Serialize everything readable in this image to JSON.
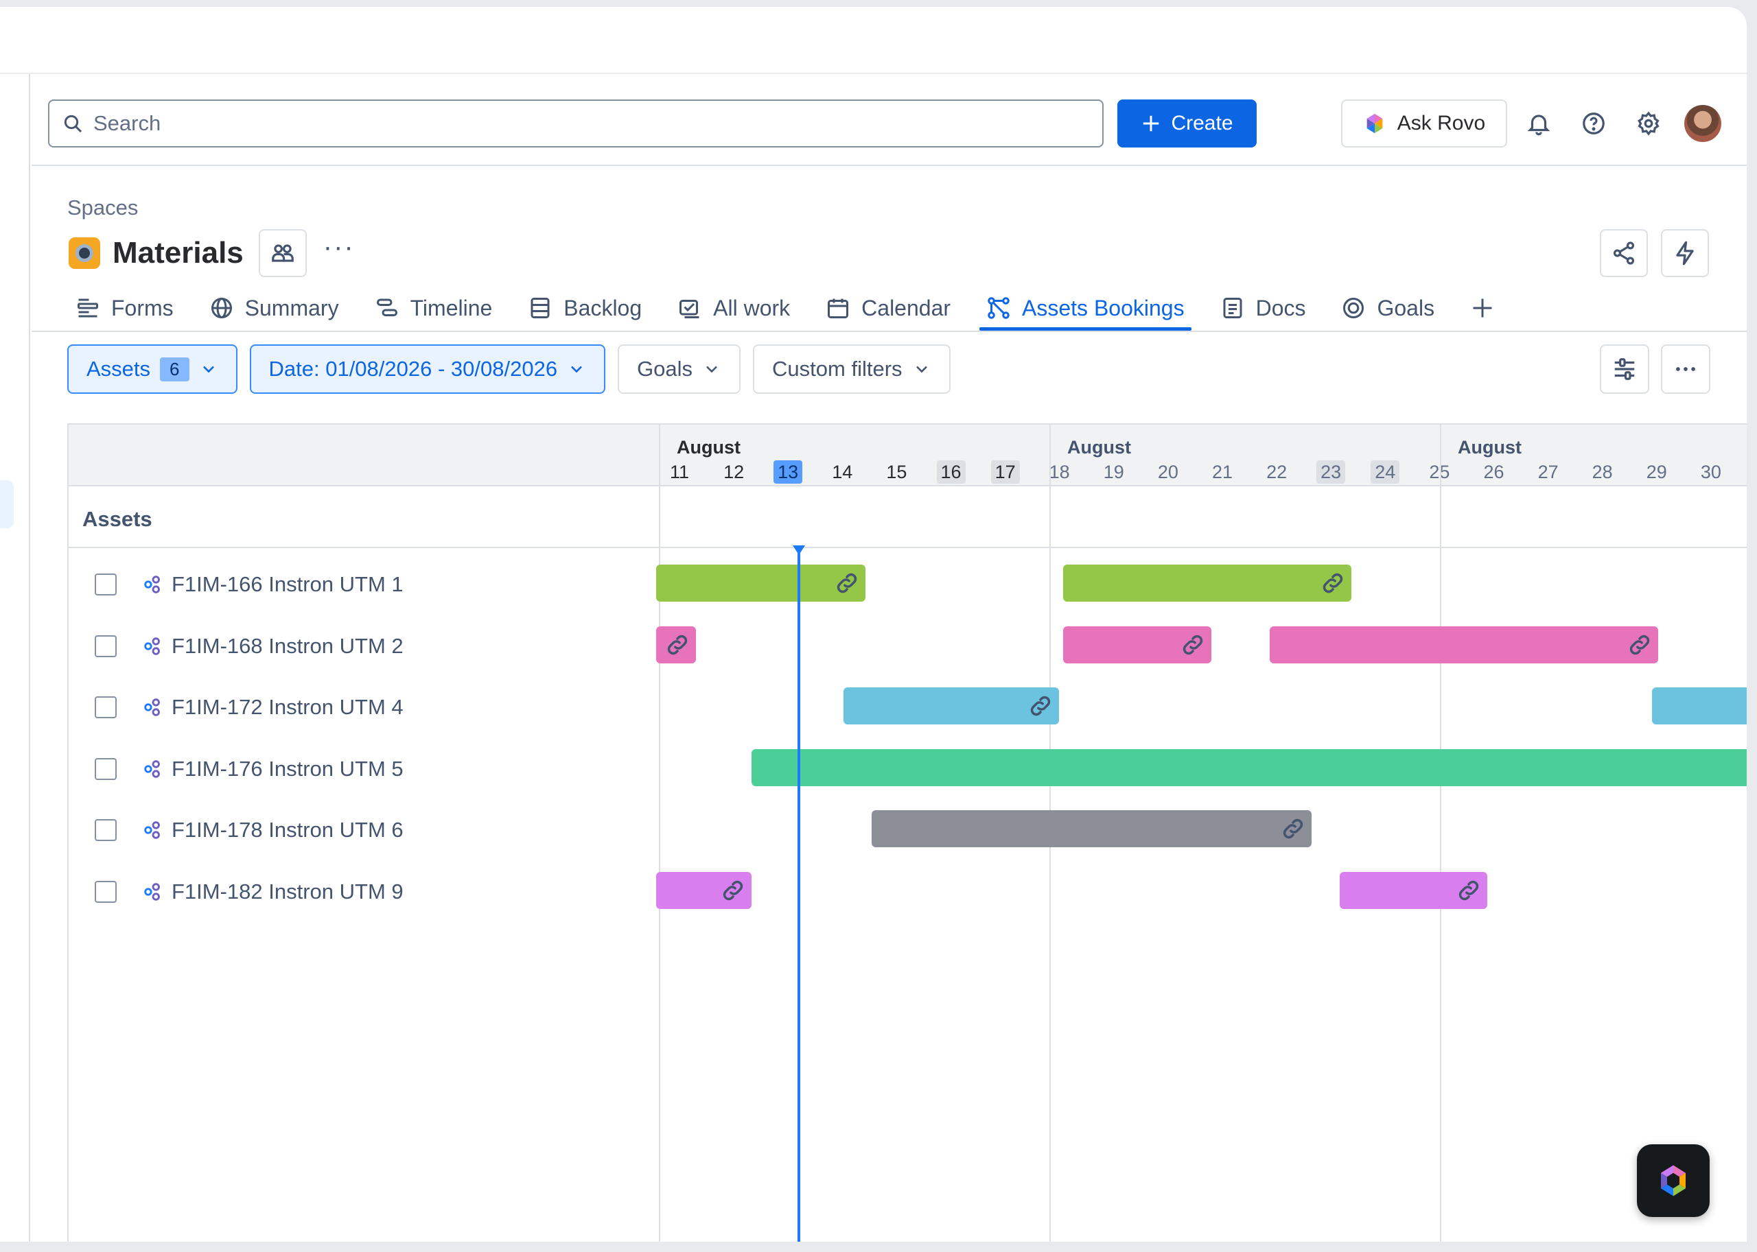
{
  "search": {
    "placeholder": "Search"
  },
  "header": {
    "create_label": "Create",
    "ask_rovo_label": "Ask Rovo"
  },
  "breadcrumb": "Spaces",
  "project": {
    "title": "Materials"
  },
  "tabs": [
    {
      "label": "Forms",
      "icon": "forms-icon"
    },
    {
      "label": "Summary",
      "icon": "globe-icon"
    },
    {
      "label": "Timeline",
      "icon": "timeline-icon"
    },
    {
      "label": "Backlog",
      "icon": "backlog-icon"
    },
    {
      "label": "All work",
      "icon": "all-work-icon"
    },
    {
      "label": "Calendar",
      "icon": "calendar-icon"
    },
    {
      "label": "Assets Bookings",
      "icon": "assets-icon",
      "active": true
    },
    {
      "label": "Docs",
      "icon": "docs-icon"
    },
    {
      "label": "Goals",
      "icon": "goals-icon"
    }
  ],
  "filters": {
    "assets_label": "Assets",
    "assets_count": "6",
    "date_label": "Date: 01/08/2026 - 30/08/2026",
    "goals_label": "Goals",
    "custom_label": "Custom filters"
  },
  "timeline": {
    "weeks": [
      {
        "month": "August",
        "days": [
          "11",
          "12",
          "13",
          "14",
          "15",
          "16",
          "17"
        ]
      },
      {
        "month": "August",
        "days": [
          "18",
          "19",
          "20",
          "21",
          "22",
          "23",
          "24"
        ]
      },
      {
        "month": "August",
        "days": [
          "25",
          "26",
          "27",
          "28",
          "29",
          "30"
        ]
      }
    ],
    "today": "13",
    "weekend_days": [
      "16",
      "17",
      "23",
      "24"
    ],
    "section_label": "Assets"
  },
  "assets": [
    {
      "label": "F1IM-166 Instron UTM 1",
      "color": "#94c748"
    },
    {
      "label": "F1IM-168 Instron UTM 2",
      "color": "#e774bb"
    },
    {
      "label": "F1IM-172 Instron UTM 4",
      "color": "#6cc3e0"
    },
    {
      "label": "F1IM-176 Instron UTM 5",
      "color": "#4bce97"
    },
    {
      "label": "F1IM-178 Instron UTM 6",
      "color": "#8c8f97"
    },
    {
      "label": "F1IM-182 Instron UTM 9",
      "color": "#d97eef"
    }
  ],
  "bookings": [
    {
      "asset": 0,
      "start": "before 11 Aug",
      "end": "14 Aug",
      "linked": true
    },
    {
      "asset": 0,
      "start": "18 Aug",
      "end": "23 Aug",
      "linked": true
    },
    {
      "asset": 1,
      "start": "before 11 Aug",
      "end": "11 Aug",
      "linked": true
    },
    {
      "asset": 1,
      "start": "18 Aug",
      "end": "20 Aug",
      "linked": true
    },
    {
      "asset": 1,
      "start": "22 Aug",
      "end": "28 Aug",
      "linked": true
    },
    {
      "asset": 2,
      "start": "14 Aug",
      "end": "17 Aug",
      "linked": true
    },
    {
      "asset": 2,
      "start": "29 Aug",
      "end": "after 30 Aug",
      "linked": false
    },
    {
      "asset": 3,
      "start": "12 Aug",
      "end": "after 30 Aug",
      "linked": false
    },
    {
      "asset": 4,
      "start": "14 Aug",
      "end": "22 Aug",
      "linked": true
    },
    {
      "asset": 5,
      "start": "before 11 Aug",
      "end": "12 Aug",
      "linked": true
    },
    {
      "asset": 5,
      "start": "23 Aug",
      "end": "25 Aug",
      "linked": true
    }
  ]
}
